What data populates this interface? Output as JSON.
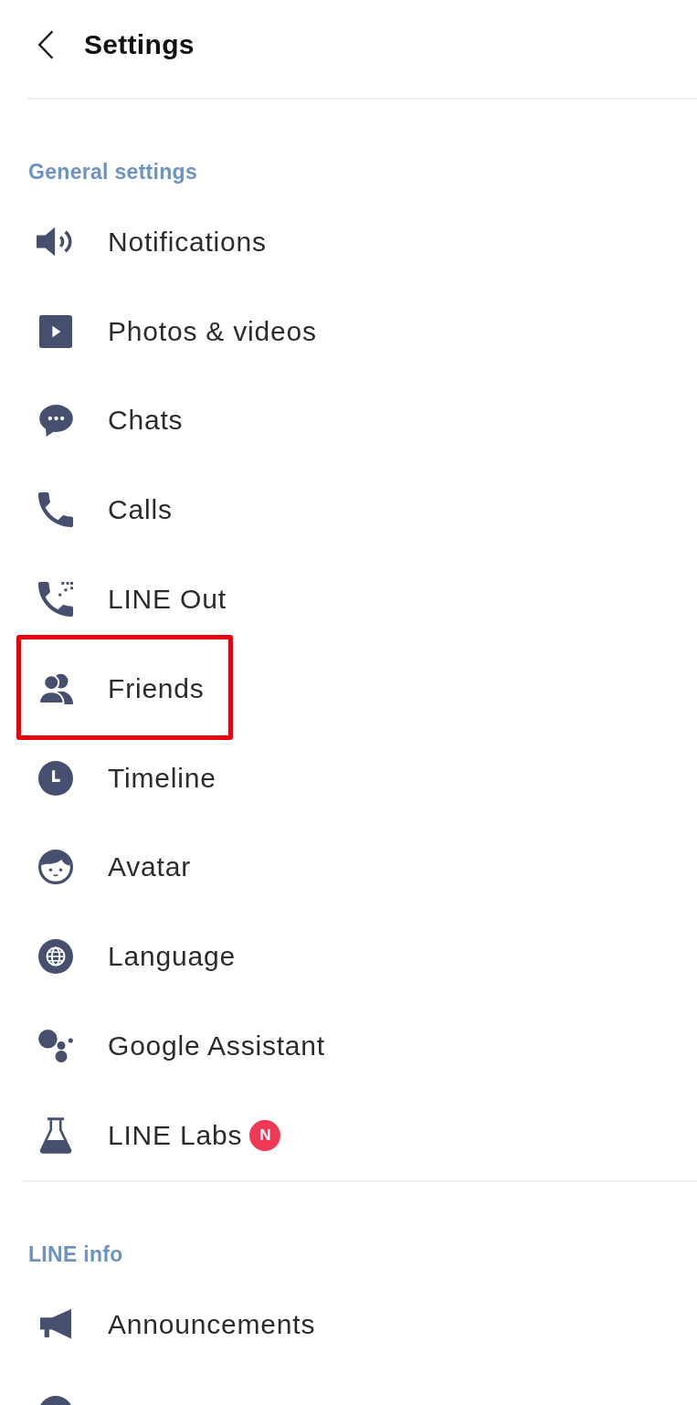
{
  "header": {
    "title": "Settings"
  },
  "sections": [
    {
      "title": "General settings",
      "items": [
        {
          "label": "Notifications",
          "highlighted": false
        },
        {
          "label": "Photos & videos",
          "highlighted": false
        },
        {
          "label": "Chats",
          "highlighted": false
        },
        {
          "label": "Calls",
          "highlighted": false
        },
        {
          "label": "LINE Out",
          "highlighted": false
        },
        {
          "label": "Friends",
          "highlighted": true
        },
        {
          "label": "Timeline",
          "highlighted": false
        },
        {
          "label": "Avatar",
          "highlighted": false
        },
        {
          "label": "Language",
          "highlighted": false
        },
        {
          "label": "Google Assistant",
          "highlighted": false
        },
        {
          "label": "LINE Labs",
          "highlighted": false,
          "badge": "N"
        }
      ]
    },
    {
      "title": "LINE info",
      "items": [
        {
          "label": "Announcements",
          "highlighted": false
        },
        {
          "highlighted": false
        }
      ]
    }
  ]
}
